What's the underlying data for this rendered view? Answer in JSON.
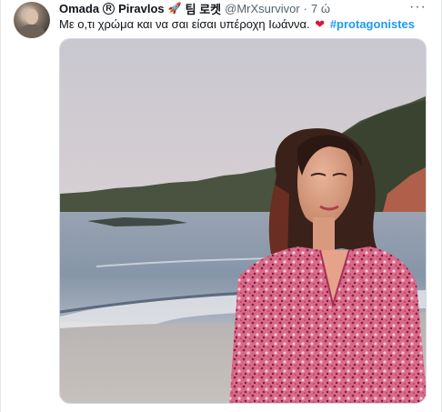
{
  "tweet": {
    "author_name": "Omada",
    "registered_mark": "R",
    "author_name_2": "Piravlos",
    "rocket_emoji": "🚀",
    "korean_text": "팀 로켓",
    "handle": "@MrXsurvivor",
    "separator": "·",
    "time": "7 ώ",
    "text": "Με ο,τι χρώμα και να σαι είσαι υπέροχη Ιωάννα.",
    "heart_emoji": "❤",
    "hashtag": "#protagonistes",
    "more_icon": "more-dots-icon",
    "colors": {
      "handle": "#536471",
      "hashtag": "#1d9bf0",
      "heart": "#d41b3a"
    }
  }
}
